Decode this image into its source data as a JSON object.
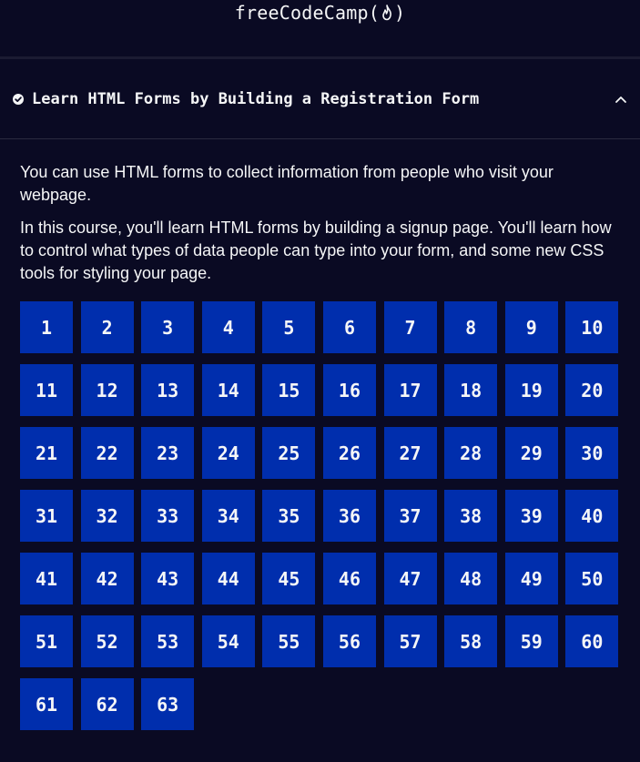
{
  "navbar": {
    "logo_text": "freeCodeCamp(",
    "logo_close": ")"
  },
  "block": {
    "title": "Learn HTML Forms by Building a Registration Form",
    "descriptions": [
      "You can use HTML forms to collect information from people who visit your webpage.",
      "In this course, you'll learn HTML forms by building a signup page. You'll learn how to control what types of data people can type into your form, and some new CSS tools for styling your page."
    ],
    "steps": [
      "1",
      "2",
      "3",
      "4",
      "5",
      "6",
      "7",
      "8",
      "9",
      "10",
      "11",
      "12",
      "13",
      "14",
      "15",
      "16",
      "17",
      "18",
      "19",
      "20",
      "21",
      "22",
      "23",
      "24",
      "25",
      "26",
      "27",
      "28",
      "29",
      "30",
      "31",
      "32",
      "33",
      "34",
      "35",
      "36",
      "37",
      "38",
      "39",
      "40",
      "41",
      "42",
      "43",
      "44",
      "45",
      "46",
      "47",
      "48",
      "49",
      "50",
      "51",
      "52",
      "53",
      "54",
      "55",
      "56",
      "57",
      "58",
      "59",
      "60",
      "61",
      "62",
      "63"
    ]
  },
  "colors": {
    "background": "#0a0a23",
    "step_tile": "#002ead",
    "text": "#f5f6f7"
  }
}
